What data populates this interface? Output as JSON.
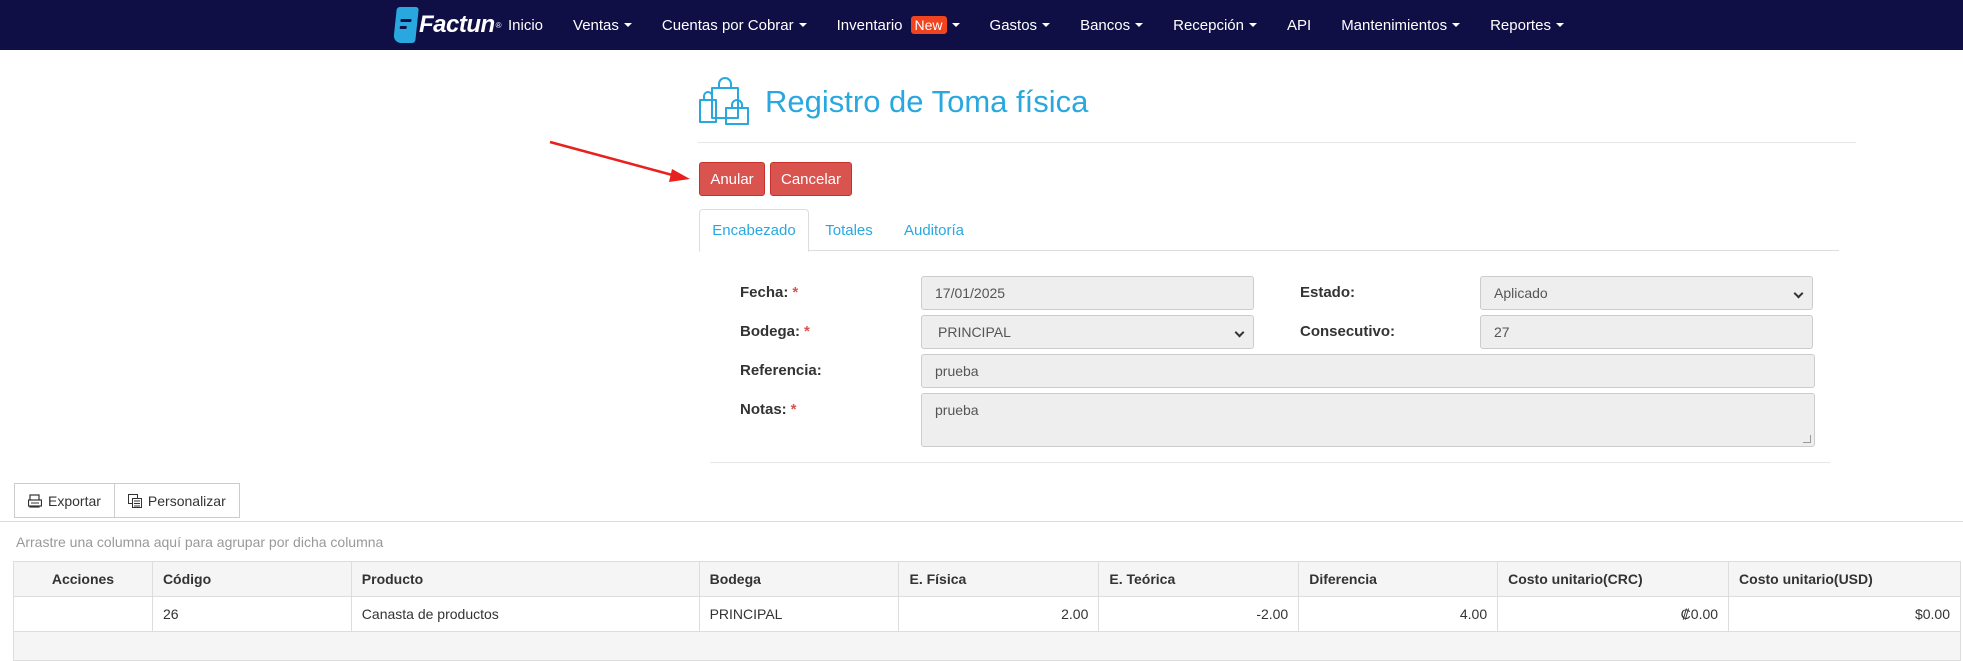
{
  "navbar": {
    "brand": "Factun",
    "brand_reg": "®",
    "items": [
      {
        "label": "Inicio",
        "caret": false
      },
      {
        "label": "Ventas",
        "caret": true
      },
      {
        "label": "Cuentas por Cobrar",
        "caret": true
      },
      {
        "label": "Inventario",
        "caret": true,
        "badge": "New"
      },
      {
        "label": "Gastos",
        "caret": true
      },
      {
        "label": "Bancos",
        "caret": true
      },
      {
        "label": "Recepción",
        "caret": true
      },
      {
        "label": "API",
        "caret": false
      },
      {
        "label": "Mantenimientos",
        "caret": true
      },
      {
        "label": "Reportes",
        "caret": true
      }
    ],
    "background_color": "#0f0e45",
    "badge_color": "#f0431f"
  },
  "page": {
    "title": "Registro de Toma física",
    "title_icon": "shopping-bags-icon",
    "accent_color": "#29a8e0"
  },
  "actions": {
    "anular": "Anular",
    "cancelar": "Cancelar",
    "danger_color": "#d9534f"
  },
  "tabs": [
    "Encabezado",
    "Totales",
    "Auditoría"
  ],
  "form": {
    "fecha": {
      "label": "Fecha:",
      "required": "*",
      "value": "17/01/2025"
    },
    "estado": {
      "label": "Estado:",
      "value": "Aplicado"
    },
    "bodega": {
      "label": "Bodega:",
      "required": "*",
      "value": "PRINCIPAL"
    },
    "consecutivo": {
      "label": "Consecutivo:",
      "value": "27"
    },
    "referencia": {
      "label": "Referencia:",
      "value": "prueba"
    },
    "notas": {
      "label": "Notas:",
      "required": "*",
      "value": "prueba"
    }
  },
  "toolbar": {
    "exportar": "Exportar",
    "personalizar": "Personalizar"
  },
  "grid": {
    "group_hint": "Arrastre una columna aquí para agrupar por dicha columna",
    "columns": [
      "Acciones",
      "Código",
      "Producto",
      "Bodega",
      "E. Física",
      "E. Teórica",
      "Diferencia",
      "Costo unitario(CRC)",
      "Costo unitario(USD)"
    ],
    "rows": [
      [
        "",
        "26",
        "Canasta de productos",
        "PRINCIPAL",
        "2.00",
        "-2.00",
        "4.00",
        "₡0.00",
        "$0.00"
      ]
    ]
  }
}
